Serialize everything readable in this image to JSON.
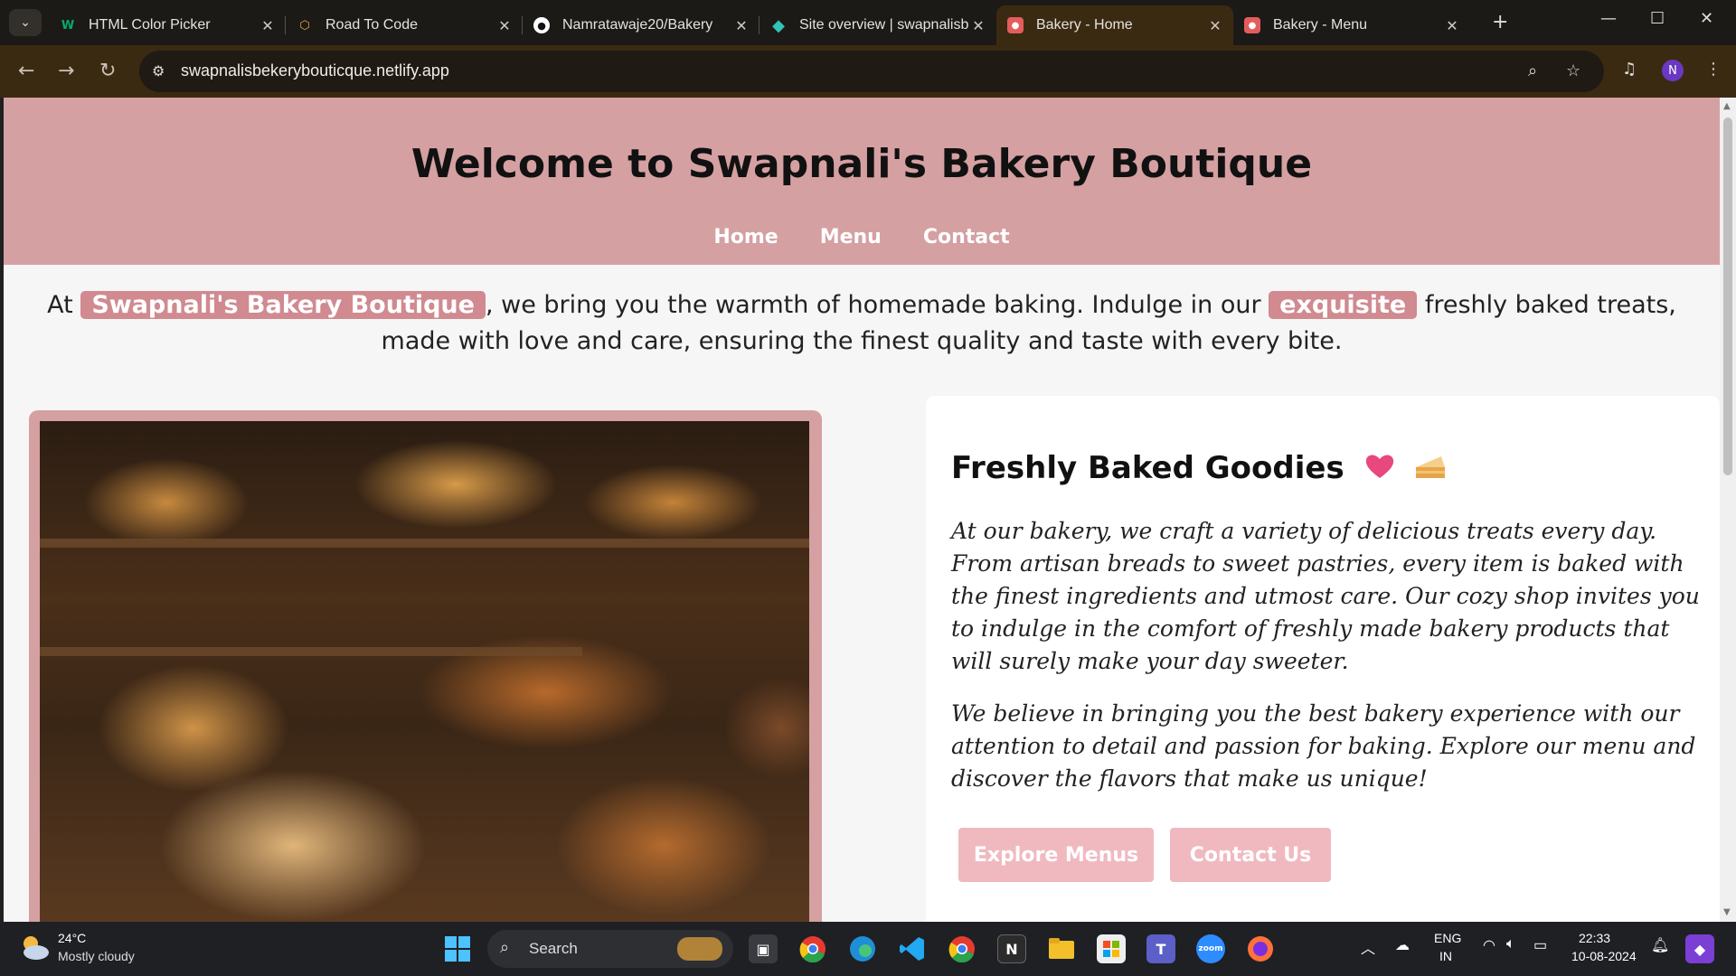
{
  "browser": {
    "tabs": [
      {
        "title": "HTML Color Picker",
        "favicon": "w3schools-icon",
        "color": "#04aa6d",
        "active": false
      },
      {
        "title": "Road To Code",
        "favicon": "hexagon-icon",
        "color": "#e7a83b",
        "active": false
      },
      {
        "title": "Namratawaje20/Bakery",
        "favicon": "github-icon",
        "color": "#ffffff",
        "active": false
      },
      {
        "title": "Site overview | swapnalisbe",
        "favicon": "netlify-icon",
        "color": "#32c4b8",
        "active": false
      },
      {
        "title": "Bakery - Home",
        "favicon": "bakery-icon",
        "color": "#e35d5d",
        "active": true
      },
      {
        "title": "Bakery - Menu",
        "favicon": "bakery-icon",
        "color": "#e35d5d",
        "active": false
      }
    ],
    "url": "swapnalisbekerybouticque.netlify.app",
    "profile_initial": "N"
  },
  "page": {
    "title": "Welcome to Swapnali's Bakery Boutique",
    "nav": [
      "Home",
      "Menu",
      "Contact"
    ],
    "intro": {
      "part1": "At ",
      "highlight1": "Swapnali's Bakery Boutique",
      "part2": ", we bring you the warmth of homemade baking. Indulge in our ",
      "highlight2": "exquisite",
      "part3": " freshly baked treats, made with love and care, ensuring the finest quality and taste with every bite."
    },
    "card": {
      "heading": "Freshly Baked Goodies",
      "para1": "At our bakery, we craft a variety of delicious treats every day. From artisan breads to sweet pastries, every item is baked with the finest ingredients and utmost care. Our cozy shop invites you to indulge in the comfort of freshly made bakery products that will surely make your day sweeter.",
      "para2": "We believe in bringing you the best bakery experience with our attention to detail and passion for baking. Explore our menu and discover the flavors that make us unique!",
      "button1": "Explore Menus",
      "button2": "Contact Us"
    },
    "colors": {
      "header": "#d5a0a2",
      "highlight": "#d08a90",
      "button": "#f0b9c0"
    }
  },
  "taskbar": {
    "temperature": "24°C",
    "weather": "Mostly cloudy",
    "search_label": "Search",
    "lang1": "ENG",
    "lang2": "IN",
    "time": "22:33",
    "date": "10-08-2024"
  }
}
